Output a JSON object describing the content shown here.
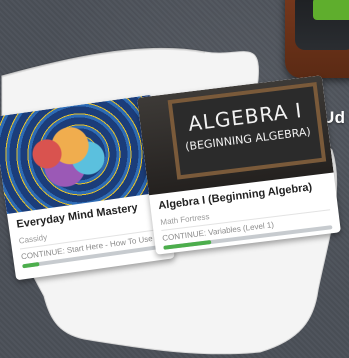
{
  "app_icon": {
    "label": "Ud",
    "icon": "udemy-app-icon",
    "accent": "#5fae2d"
  },
  "courses": [
    {
      "title": "Everyday Mind Mastery",
      "author": "Cassidy",
      "continue_text": "CONTINUE: Start Here - How To Use This...",
      "progress": 0.12,
      "thumbnail_icon": "brain-illustration"
    },
    {
      "title": "Algebra I (Beginning Algebra)",
      "author": "Math Fortress",
      "continue_text": "CONTINUE: Variables (Level 1)",
      "progress": 0.28,
      "thumbnail_lines": [
        "ALGEBRA I",
        "(BEGINNING ALGEBRA)"
      ]
    }
  ],
  "colors": {
    "background": "#4b5058",
    "progress": "#4cae4c",
    "progress_track": "#c7cbcf"
  }
}
